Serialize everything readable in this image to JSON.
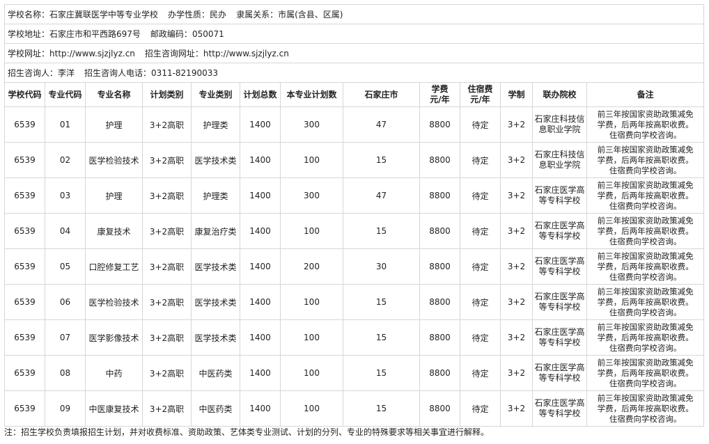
{
  "school": {
    "name_label": "学校名称：",
    "name": "石家庄冀联医学中等专业学校",
    "nature_label": "办学性质：",
    "nature": "民办",
    "affiliation_label": "隶属关系：",
    "affiliation": "市属(含县、区属)",
    "address_label": "学校地址：",
    "address": "石家庄市和平西路697号",
    "postcode_label": "邮政编码：",
    "postcode": "050071",
    "website_label": "学校网址：",
    "website": "http://www.sjzjlyz.cn",
    "enroll_site_label": "招生咨询网址：",
    "enroll_site": "http://www.sjzjlyz.cn",
    "contact_label": "招生咨询人：",
    "contact": "李洋",
    "phone_label": "招生咨询人电话：",
    "phone": "0311-82190033"
  },
  "table": {
    "headers": [
      [
        "学校代码"
      ],
      [
        "专业代码"
      ],
      [
        "专业名称"
      ],
      [
        "计划类别"
      ],
      [
        "专业类别"
      ],
      [
        "计划总数"
      ],
      [
        "本专业计划数"
      ],
      [
        "石家庄市"
      ],
      [
        "学费",
        "元/年"
      ],
      [
        "住宿费",
        "元/年"
      ],
      [
        "学制"
      ],
      [
        "联办院校"
      ],
      [
        "备注"
      ]
    ],
    "rows": [
      {
        "school_code": "6539",
        "major_code": "01",
        "major_name": "护理",
        "plan_type": "3+2高职",
        "major_category": "护理类",
        "plan_total": "1400",
        "major_plan": "300",
        "sjz": "47",
        "tuition": "8800",
        "dorm_fee": "待定",
        "duration": "3+2",
        "partner": [
          "石家庄科技信",
          "息职业学院"
        ],
        "remark": [
          "前三年按国家资助政策减免",
          "学费，后两年按高职收费。",
          "住宿费向学校咨询。"
        ]
      },
      {
        "school_code": "6539",
        "major_code": "02",
        "major_name": "医学检验技术",
        "plan_type": "3+2高职",
        "major_category": "医学技术类",
        "plan_total": "1400",
        "major_plan": "100",
        "sjz": "15",
        "tuition": "8800",
        "dorm_fee": "待定",
        "duration": "3+2",
        "partner": [
          "石家庄科技信",
          "息职业学院"
        ],
        "remark": [
          "前三年按国家资助政策减免",
          "学费，后两年按高职收费。",
          "住宿费向学校咨询。"
        ]
      },
      {
        "school_code": "6539",
        "major_code": "03",
        "major_name": "护理",
        "plan_type": "3+2高职",
        "major_category": "护理类",
        "plan_total": "1400",
        "major_plan": "300",
        "sjz": "47",
        "tuition": "8800",
        "dorm_fee": "待定",
        "duration": "3+2",
        "partner": [
          "石家庄医学高",
          "等专科学校"
        ],
        "remark": [
          "前三年按国家资助政策减免",
          "学费，后两年按高职收费。",
          "住宿费向学校咨询。"
        ]
      },
      {
        "school_code": "6539",
        "major_code": "04",
        "major_name": "康复技术",
        "plan_type": "3+2高职",
        "major_category": "康复治疗类",
        "plan_total": "1400",
        "major_plan": "100",
        "sjz": "15",
        "tuition": "8800",
        "dorm_fee": "待定",
        "duration": "3+2",
        "partner": [
          "石家庄医学高",
          "等专科学校"
        ],
        "remark": [
          "前三年按国家资助政策减免",
          "学费，后两年按高职收费。",
          "住宿费向学校咨询。"
        ]
      },
      {
        "school_code": "6539",
        "major_code": "05",
        "major_name": "口腔修复工艺",
        "plan_type": "3+2高职",
        "major_category": "医学技术类",
        "plan_total": "1400",
        "major_plan": "200",
        "sjz": "30",
        "tuition": "8800",
        "dorm_fee": "待定",
        "duration": "3+2",
        "partner": [
          "石家庄医学高",
          "等专科学校"
        ],
        "remark": [
          "前三年按国家资助政策减免",
          "学费，后两年按高职收费。",
          "住宿费向学校咨询。"
        ]
      },
      {
        "school_code": "6539",
        "major_code": "06",
        "major_name": "医学检验技术",
        "plan_type": "3+2高职",
        "major_category": "医学技术类",
        "plan_total": "1400",
        "major_plan": "100",
        "sjz": "15",
        "tuition": "8800",
        "dorm_fee": "待定",
        "duration": "3+2",
        "partner": [
          "石家庄医学高",
          "等专科学校"
        ],
        "remark": [
          "前三年按国家资助政策减免",
          "学费，后两年按高职收费。",
          "住宿费向学校咨询。"
        ]
      },
      {
        "school_code": "6539",
        "major_code": "07",
        "major_name": "医学影像技术",
        "plan_type": "3+2高职",
        "major_category": "医学技术类",
        "plan_total": "1400",
        "major_plan": "100",
        "sjz": "15",
        "tuition": "8800",
        "dorm_fee": "待定",
        "duration": "3+2",
        "partner": [
          "石家庄医学高",
          "等专科学校"
        ],
        "remark": [
          "前三年按国家资助政策减免",
          "学费，后两年按高职收费。",
          "住宿费向学校咨询。"
        ]
      },
      {
        "school_code": "6539",
        "major_code": "08",
        "major_name": "中药",
        "plan_type": "3+2高职",
        "major_category": "中医药类",
        "plan_total": "1400",
        "major_plan": "100",
        "sjz": "15",
        "tuition": "8800",
        "dorm_fee": "待定",
        "duration": "3+2",
        "partner": [
          "石家庄医学高",
          "等专科学校"
        ],
        "remark": [
          "前三年按国家资助政策减免",
          "学费，后两年按高职收费。",
          "住宿费向学校咨询。"
        ]
      },
      {
        "school_code": "6539",
        "major_code": "09",
        "major_name": "中医康复技术",
        "plan_type": "3+2高职",
        "major_category": "中医药类",
        "plan_total": "1400",
        "major_plan": "100",
        "sjz": "15",
        "tuition": "8800",
        "dorm_fee": "待定",
        "duration": "3+2",
        "partner": [
          "石家庄医学高",
          "等专科学校"
        ],
        "remark": [
          "前三年按国家资助政策减免",
          "学费，后两年按高职收费。",
          "住宿费向学校咨询。"
        ]
      }
    ]
  },
  "note": "注：招生学校负责填报招生计划，并对收费标准、资助政策、艺体类专业测试、计划的分列、专业的特殊要求等相关事宜进行解释。"
}
